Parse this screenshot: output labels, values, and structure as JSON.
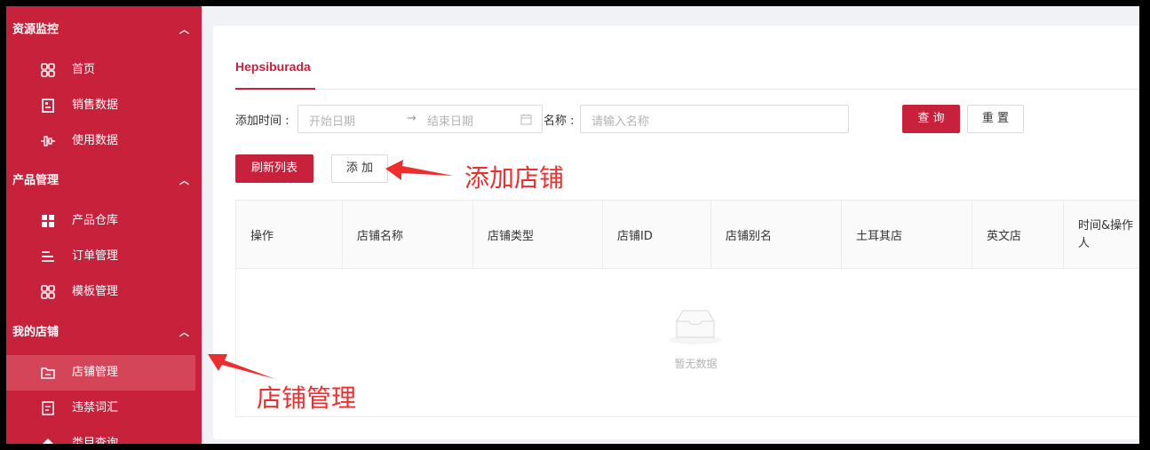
{
  "sidebar": {
    "groups": [
      {
        "title": "资源监控",
        "items": [
          "首页",
          "销售数据",
          "使用数据"
        ]
      },
      {
        "title": "产品管理",
        "items": [
          "产品仓库",
          "订单管理",
          "模板管理"
        ]
      },
      {
        "title": "我的店铺",
        "items": [
          "店铺管理",
          "违禁词汇",
          "类目查询"
        ]
      }
    ],
    "active_item": "店铺管理"
  },
  "main": {
    "tab": "Hepsiburada",
    "filters": {
      "time_label": "添加时间 :",
      "start_placeholder": "开始日期",
      "end_placeholder": "结束日期",
      "range_separator": "→",
      "name_label": "名称 :",
      "name_placeholder": "请输入名称"
    },
    "buttons": {
      "query": "查 询",
      "reset": "重 置",
      "refresh": "刷新列表",
      "add": "添 加"
    },
    "table": {
      "columns": [
        "操作",
        "店铺名称",
        "店铺类型",
        "店铺ID",
        "店铺别名",
        "土耳其店",
        "英文店",
        "时间&操作人"
      ],
      "empty_text": "暂无数据"
    }
  },
  "annotations": {
    "add_store": "添加店铺",
    "store_manage": "店铺管理",
    "color": "#ee2e2e"
  },
  "theme": {
    "primary": "#c8213c",
    "active_bg": "#d54559"
  }
}
